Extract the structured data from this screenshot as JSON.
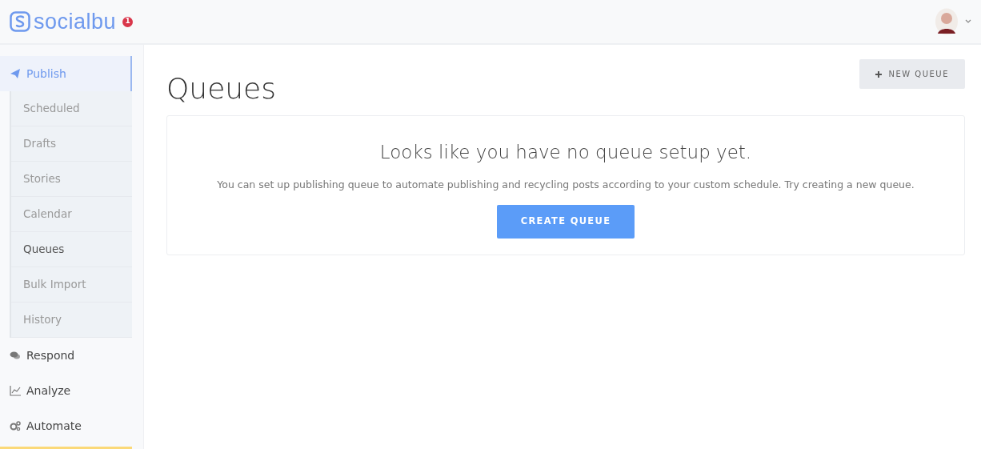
{
  "brand": {
    "name": "socialbu",
    "notification_count": "1"
  },
  "sidebar": {
    "items": [
      {
        "label": "Publish",
        "selected": true,
        "children": [
          {
            "label": "Scheduled",
            "selected": false
          },
          {
            "label": "Drafts",
            "selected": false
          },
          {
            "label": "Stories",
            "selected": false
          },
          {
            "label": "Calendar",
            "selected": false
          },
          {
            "label": "Queues",
            "selected": true
          },
          {
            "label": "Bulk Import",
            "selected": false
          },
          {
            "label": "History",
            "selected": false
          }
        ]
      },
      {
        "label": "Respond",
        "selected": false
      },
      {
        "label": "Analyze",
        "selected": false
      },
      {
        "label": "Automate",
        "selected": false
      }
    ]
  },
  "page": {
    "title": "Queues",
    "new_button": "NEW QUEUE"
  },
  "empty_state": {
    "heading": "Looks like you have no queue setup yet.",
    "text": "You can set up publishing queue to automate publishing and recycling posts according to your custom schedule. Try creating a new queue.",
    "button": "CREATE QUEUE"
  }
}
